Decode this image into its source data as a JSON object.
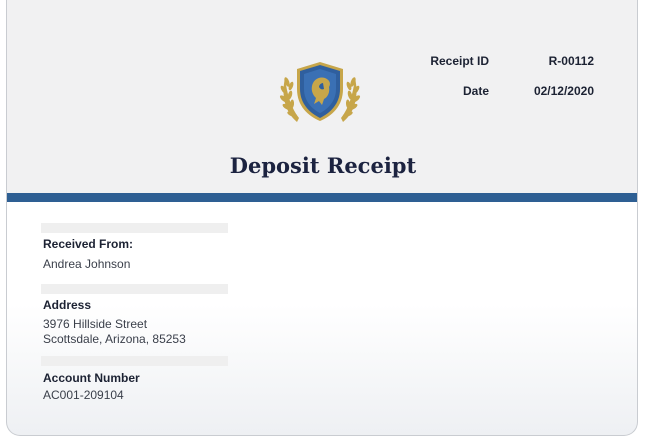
{
  "document": {
    "title": "Deposit Receipt",
    "logo": {
      "icon": "lion-crest-shield-with-laurel-wreath"
    }
  },
  "meta": {
    "receipt_id_label": "Receipt ID",
    "receipt_id_value": "R-00112",
    "date_label": "Date",
    "date_value": "02/12/2020"
  },
  "fields": {
    "received_from_label": "Received From:",
    "received_from_value": "Andrea Johnson",
    "address_label": "Address",
    "address_line1": "3976 Hillside Street",
    "address_line2": "Scottsdale, Arizona, 85253",
    "account_number_label": "Account Number",
    "account_number_value": "AC001-209104"
  },
  "colors": {
    "accent_bar": "#2e5f93",
    "shield_blue": "#2f5f9e",
    "laurel_gold": "#c7a64a",
    "header_bg": "#f1f1f2"
  }
}
